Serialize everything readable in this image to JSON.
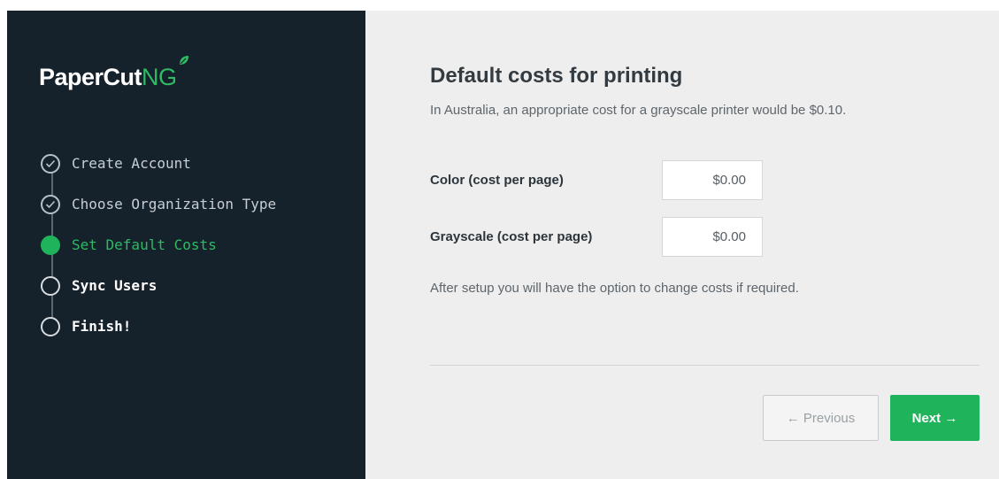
{
  "brand": {
    "name_main": "PaperCut",
    "name_suffix": "NG",
    "accent": "#2fba64",
    "sidebar_bg": "#15212b"
  },
  "steps": [
    {
      "label": "Create Account",
      "state": "done",
      "icon": "check-circle-icon"
    },
    {
      "label": "Choose Organization Type",
      "state": "done",
      "icon": "check-circle-icon"
    },
    {
      "label": "Set Default Costs",
      "state": "active",
      "icon": "filled-circle-icon"
    },
    {
      "label": "Sync Users",
      "state": "todo",
      "icon": "empty-circle-icon"
    },
    {
      "label": "Finish!",
      "state": "todo",
      "icon": "empty-circle-icon"
    }
  ],
  "main": {
    "title": "Default costs for printing",
    "subtitle": "In Australia, an appropriate cost for a grayscale printer would be $0.10.",
    "fields": {
      "color": {
        "label": "Color (cost per page)",
        "value": "$0.00"
      },
      "grayscale": {
        "label": "Grayscale (cost per page)",
        "value": "$0.00"
      }
    },
    "note": "After setup you will have the option to change costs if required."
  },
  "buttons": {
    "previous": "← Previous",
    "next": "Next →"
  }
}
